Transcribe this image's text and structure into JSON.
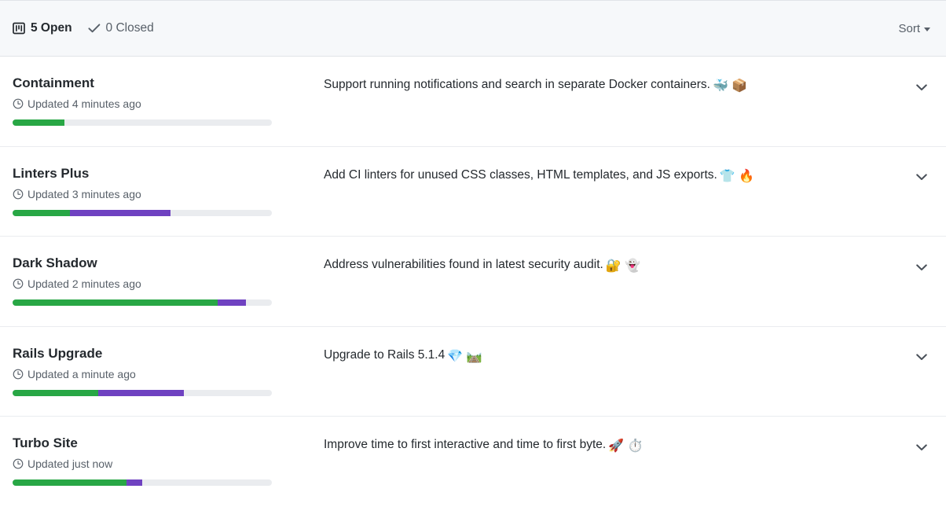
{
  "header": {
    "open_count_label": "5 Open",
    "closed_count_label": "0 Closed",
    "sort_label": "Sort",
    "milestone_icon": "milestone-icon",
    "check_icon": "check-icon",
    "caret_icon": "caret-down-icon"
  },
  "colors": {
    "progress_green": "#28a745",
    "progress_purple": "#6f42c1",
    "progress_track": "#eaecef",
    "header_bg": "#f6f8fa",
    "border": "#e1e4e8",
    "text_primary": "#24292e",
    "text_muted": "#586069"
  },
  "milestones": [
    {
      "title": "Containment",
      "updated": "Updated 4 minutes ago",
      "description": "Support running notifications and search in separate Docker containers.",
      "emoji": "🐳 📦",
      "progress": {
        "green_pct": 20,
        "purple_pct": 0
      },
      "clock_icon": "clock-icon",
      "expand_icon": "chevron-down-icon"
    },
    {
      "title": "Linters Plus",
      "updated": "Updated 3 minutes ago",
      "description": "Add CI linters for unused CSS classes, HTML templates, and JS exports.",
      "emoji": "👕 🔥",
      "progress": {
        "green_pct": 22,
        "purple_pct": 39
      },
      "clock_icon": "clock-icon",
      "expand_icon": "chevron-down-icon"
    },
    {
      "title": "Dark Shadow",
      "updated": "Updated 2 minutes ago",
      "description": "Address vulnerabilities found in latest security audit.",
      "emoji": "🔐 👻",
      "progress": {
        "green_pct": 79,
        "purple_pct": 11
      },
      "clock_icon": "clock-icon",
      "expand_icon": "chevron-down-icon"
    },
    {
      "title": "Rails Upgrade",
      "updated": "Updated a minute ago",
      "description": "Upgrade to Rails 5.1.4",
      "emoji": "💎 🛤️",
      "progress": {
        "green_pct": 33,
        "purple_pct": 33
      },
      "clock_icon": "clock-icon",
      "expand_icon": "chevron-down-icon"
    },
    {
      "title": "Turbo Site",
      "updated": "Updated just now",
      "description": "Improve time to first interactive and time to first byte.",
      "emoji": "🚀 ⏱️",
      "progress": {
        "green_pct": 44,
        "purple_pct": 6
      },
      "clock_icon": "clock-icon",
      "expand_icon": "chevron-down-icon"
    }
  ]
}
